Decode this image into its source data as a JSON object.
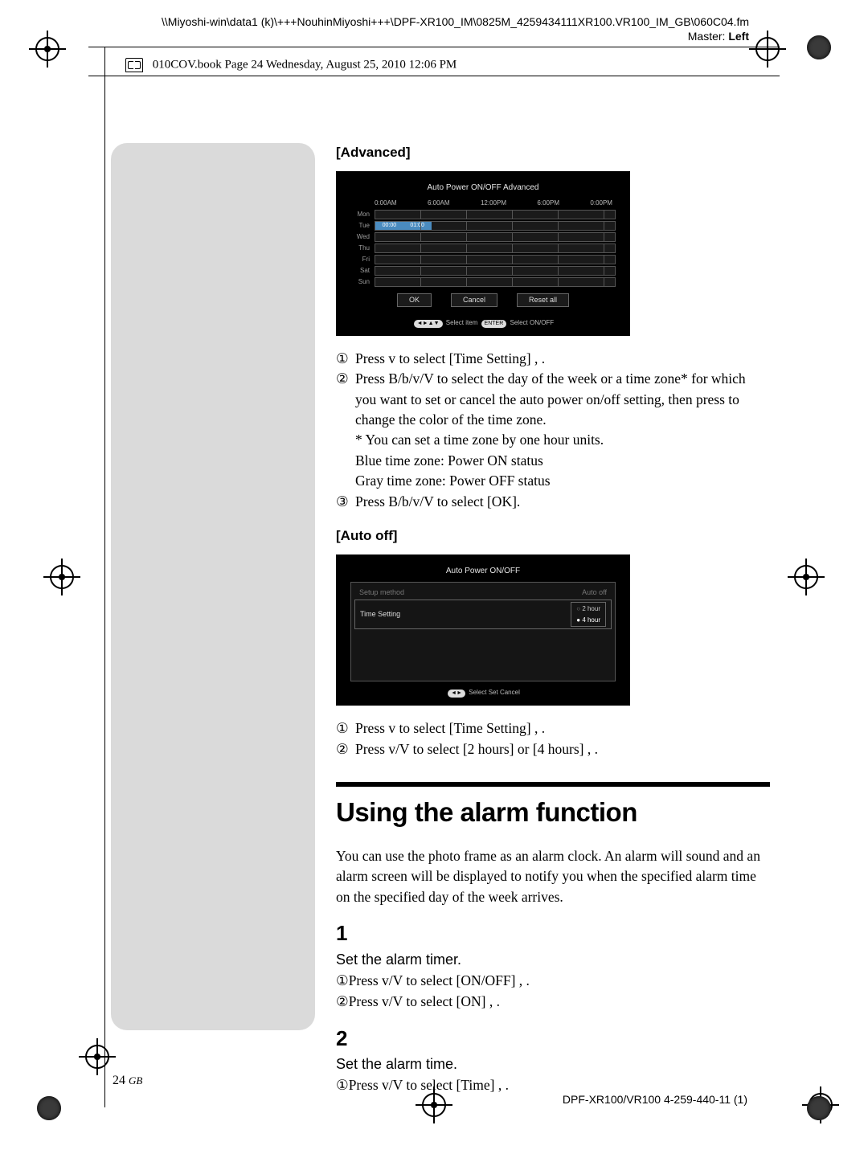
{
  "header": {
    "path": "\\\\Miyoshi-win\\data1 (k)\\+++NouhinMiyoshi+++\\DPF-XR100_IM\\0825M_4259434111XR100.VR100_IM_GB\\060C04.fm",
    "master_label": "Master:",
    "master_value": "Left",
    "book_info": "010COV.book  Page 24  Wednesday, August 25, 2010  12:06 PM"
  },
  "advanced": {
    "heading": "[Advanced]",
    "screenshot": {
      "title": "Auto Power ON/OFF   Advanced",
      "times": [
        "0:00AM",
        "6:00AM",
        "12:00PM",
        "6:00PM",
        "0:00PM"
      ],
      "days": [
        "Mon",
        "Tue",
        "Wed",
        "Thu",
        "Fri",
        "Sat",
        "Sun"
      ],
      "seg_labels": [
        "00:00",
        "01:00"
      ],
      "buttons": [
        "OK",
        "Cancel",
        "Reset all"
      ],
      "hint_left": "Select item",
      "hint_right": "Select ON/OFF"
    },
    "steps": {
      "s1": "Press v to select [Time Setting] , .",
      "s2a": "Press B/b/v/V to select the day of the week or a time zone* for which you want to set or cancel the auto power on/off setting, then press   to change the color of the time zone.",
      "s2b": "* You can set a time zone by one hour units.",
      "s2c": "Blue time zone: Power ON status",
      "s2d": "Gray time zone: Power OFF status",
      "s3": "Press B/b/v/V to select [OK]."
    }
  },
  "autooff": {
    "heading": "[Auto off]",
    "screenshot": {
      "title": "Auto Power ON/OFF",
      "row1_label": "Setup method",
      "row1_value": "Auto off",
      "row2_label": "Time Setting",
      "opts": [
        "2 hour",
        "4 hour"
      ],
      "hint": "Select    Set    Cancel"
    },
    "steps": {
      "s1": "Press v to select [Time Setting] , .",
      "s2": "Press v/V to select [2 hours] or [4 hours] , ."
    }
  },
  "section": {
    "title": "Using the alarm function",
    "intro": "You can use the photo frame as an alarm clock. An alarm will sound and an alarm screen will be displayed to notify you when the specified alarm time on the specified day of the week arrives."
  },
  "mainsteps": {
    "s1_head": "Set the alarm timer.",
    "s1_a": "Press v/V to select [ON/OFF] , .",
    "s1_b": "Press v/V to select [ON] , .",
    "s2_head": "Set the alarm time.",
    "s2_a": "Press v/V to select [Time] , ."
  },
  "footer": {
    "page_num": "24",
    "page_lang": "GB",
    "doc_id": "DPF-XR100/VR100 4-259-440-11 (1)"
  },
  "nums": {
    "c1": "1",
    "c2": "2",
    "c3": "3",
    "big1": "1",
    "big2": "2"
  }
}
